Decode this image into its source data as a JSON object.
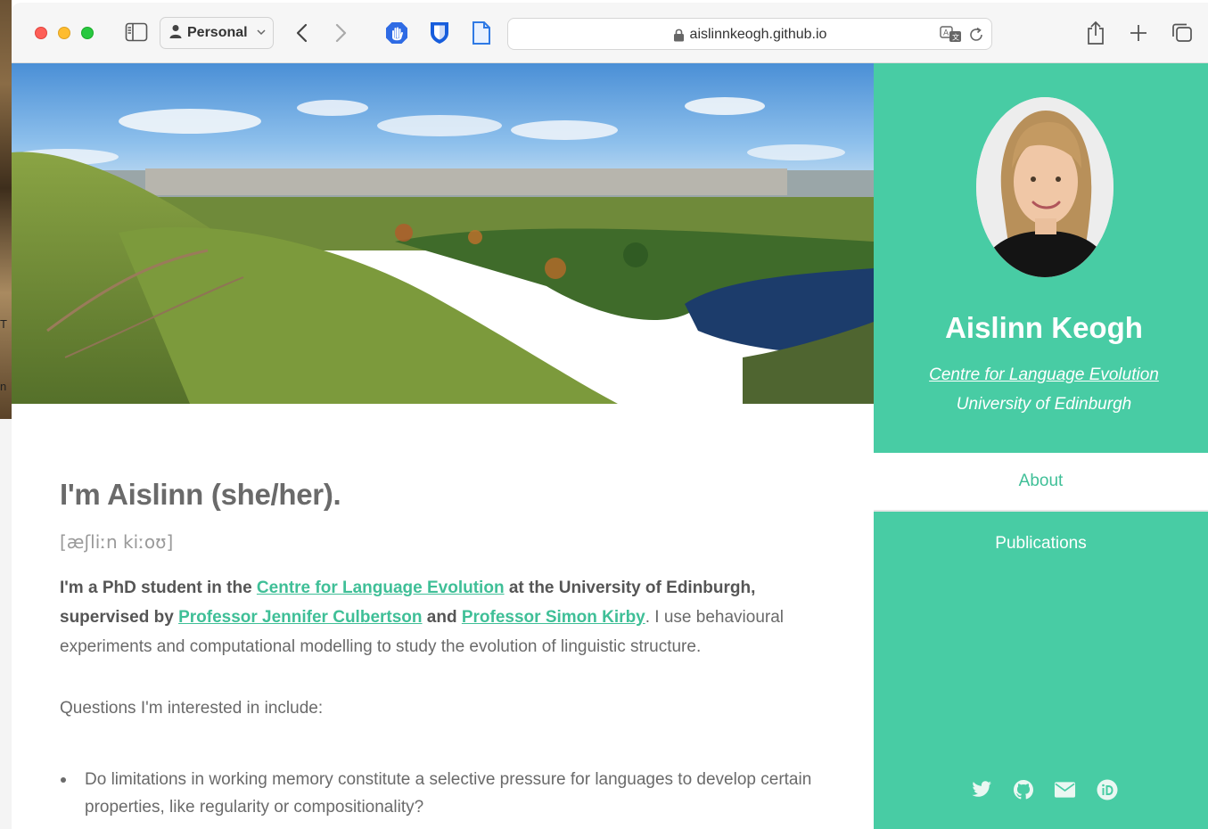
{
  "browser": {
    "profile_label": "Personal",
    "url": "aislinnkeogh.github.io",
    "icons": [
      "sidebar-icon",
      "person-icon",
      "chevron-down-icon",
      "back-icon",
      "forward-icon",
      "hand-shield-icon",
      "bitwarden-icon",
      "document-icon",
      "lock-icon",
      "translate-icon",
      "reload-icon",
      "share-icon",
      "plus-icon",
      "tabs-icon"
    ]
  },
  "desktop": {
    "fragment_1": "T",
    "fragment_2": "n"
  },
  "main": {
    "title": "I'm Aislinn (she/her).",
    "ipa": "[æʃliːn kiːoʊ]",
    "intro": {
      "p1": "I'm a PhD student in the ",
      "link1": "Centre for Language Evolution",
      "p2": " at the University of Edinburgh, supervised by ",
      "link2": "Professor Jennifer Culbertson",
      "p3": " and ",
      "link3": "Professor Simon Kirby",
      "p4": ". I use behavioural experiments and computational modelling to study the evolution of linguistic structure."
    },
    "questions_label": "Questions I'm interested in include:",
    "bullets": [
      "Do limitations in working memory constitute a selective pressure for languages to develop certain properties, like regularity or compositionality?"
    ]
  },
  "sidebar": {
    "name": "Aislinn Keogh",
    "affiliation_link": "Centre for Language Evolution",
    "affiliation": "University of Edinburgh",
    "nav": {
      "about": "About",
      "publications": "Publications"
    },
    "socials": [
      "twitter-icon",
      "github-icon",
      "email-icon",
      "orcid-icon"
    ]
  },
  "colors": {
    "accent": "#48cca4",
    "link": "#3fbf97",
    "text": "#6a6a6a"
  }
}
